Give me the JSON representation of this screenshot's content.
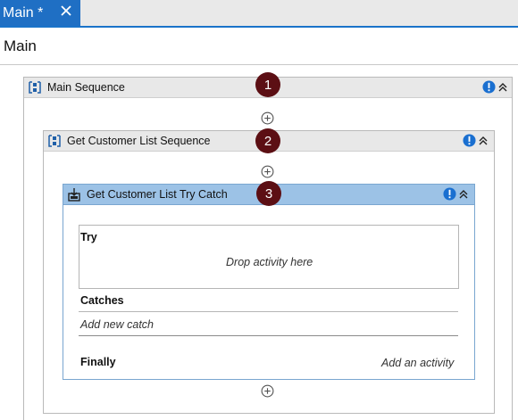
{
  "tab": {
    "label": "Main *",
    "close_icon": "close-icon"
  },
  "page": {
    "title": "Main"
  },
  "main_sequence": {
    "title": "Main Sequence",
    "badge": "1"
  },
  "customer_sequence": {
    "title": "Get Customer List Sequence",
    "badge": "2"
  },
  "try_catch": {
    "title": "Get Customer List Try Catch",
    "badge": "3",
    "try_label": "Try",
    "drop_hint": "Drop activity here",
    "catches_label": "Catches",
    "add_catch": "Add new catch",
    "finally_label": "Finally",
    "add_activity": "Add an activity"
  },
  "colors": {
    "tab": "#1f6fc4",
    "header_gray": "#e8e8e8",
    "header_blue": "#9cc2e6",
    "badge": "#5c0f14",
    "warning": "#1a6fd0"
  }
}
